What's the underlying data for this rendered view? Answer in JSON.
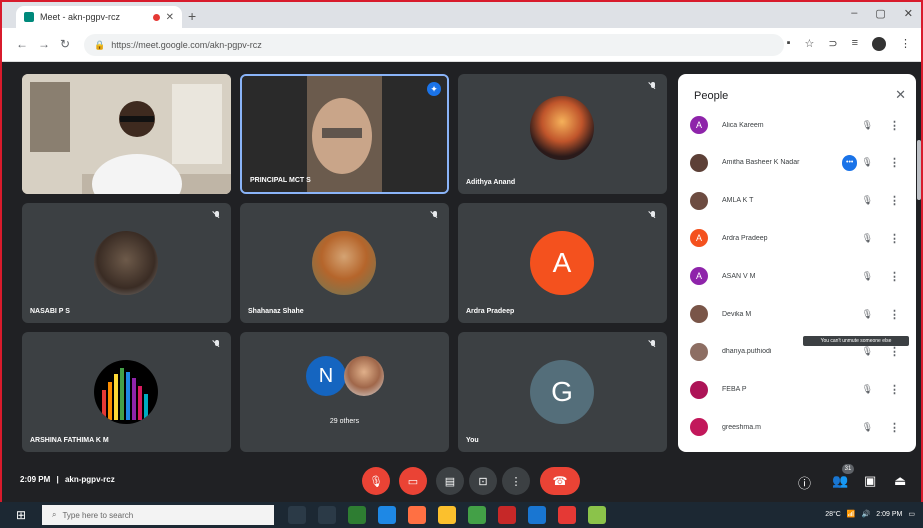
{
  "browser": {
    "tab_title": "Meet - akn-pgpv-rcz",
    "new_tab": "+",
    "url": "https://meet.google.com/akn-pgpv-rcz",
    "window_controls": [
      "–",
      "▢",
      "✕"
    ]
  },
  "meeting": {
    "time": "2:09 PM",
    "separator": "|",
    "code": "akn-pgpv-rcz",
    "participant_count": "31"
  },
  "tiles": [
    {
      "name": "",
      "type": "video-room"
    },
    {
      "name": "PRINCIPAL MCT S",
      "type": "video-person"
    },
    {
      "name": "Adithya Anand",
      "type": "photo"
    },
    {
      "name": "NASABI P S",
      "type": "photo"
    },
    {
      "name": "Shahanaz Shahe",
      "type": "photo"
    },
    {
      "name": "Ardra Pradeep",
      "type": "letter",
      "letter": "A",
      "color": "#f4511e"
    },
    {
      "name": "ARSHINA FATHIMA K M",
      "type": "photo"
    },
    {
      "name": "29 others",
      "type": "others",
      "letter": "N"
    },
    {
      "name": "You",
      "type": "letter",
      "letter": "G",
      "color": "#546e7a"
    }
  ],
  "people_panel": {
    "title": "People",
    "close": "✕",
    "tooltip": "You can't unmute someone else",
    "rows": [
      {
        "name": "Alica Kareem",
        "avatar": "A",
        "color": "#8e24aa"
      },
      {
        "name": "Amitha Basheer K Nadar",
        "avatar": "",
        "color": "#5d4037",
        "badge": "•••"
      },
      {
        "name": "AMLA K T",
        "avatar": "",
        "color": "#6d4c41"
      },
      {
        "name": "Ardra Pradeep",
        "avatar": "A",
        "color": "#f4511e"
      },
      {
        "name": "ASAN V M",
        "avatar": "A",
        "color": "#8e24aa"
      },
      {
        "name": "Devika M",
        "avatar": "",
        "color": "#795548"
      },
      {
        "name": "dhanya.puthiodi",
        "avatar": "",
        "color": "#8d6e63"
      },
      {
        "name": "FEBA P",
        "avatar": "",
        "color": "#ad1457"
      },
      {
        "name": "greeshma.m",
        "avatar": "",
        "color": "#c2185b"
      }
    ]
  },
  "taskbar": {
    "search_placeholder": "Type here to search",
    "clock_time": "2:09 PM",
    "weather": "28°C"
  }
}
